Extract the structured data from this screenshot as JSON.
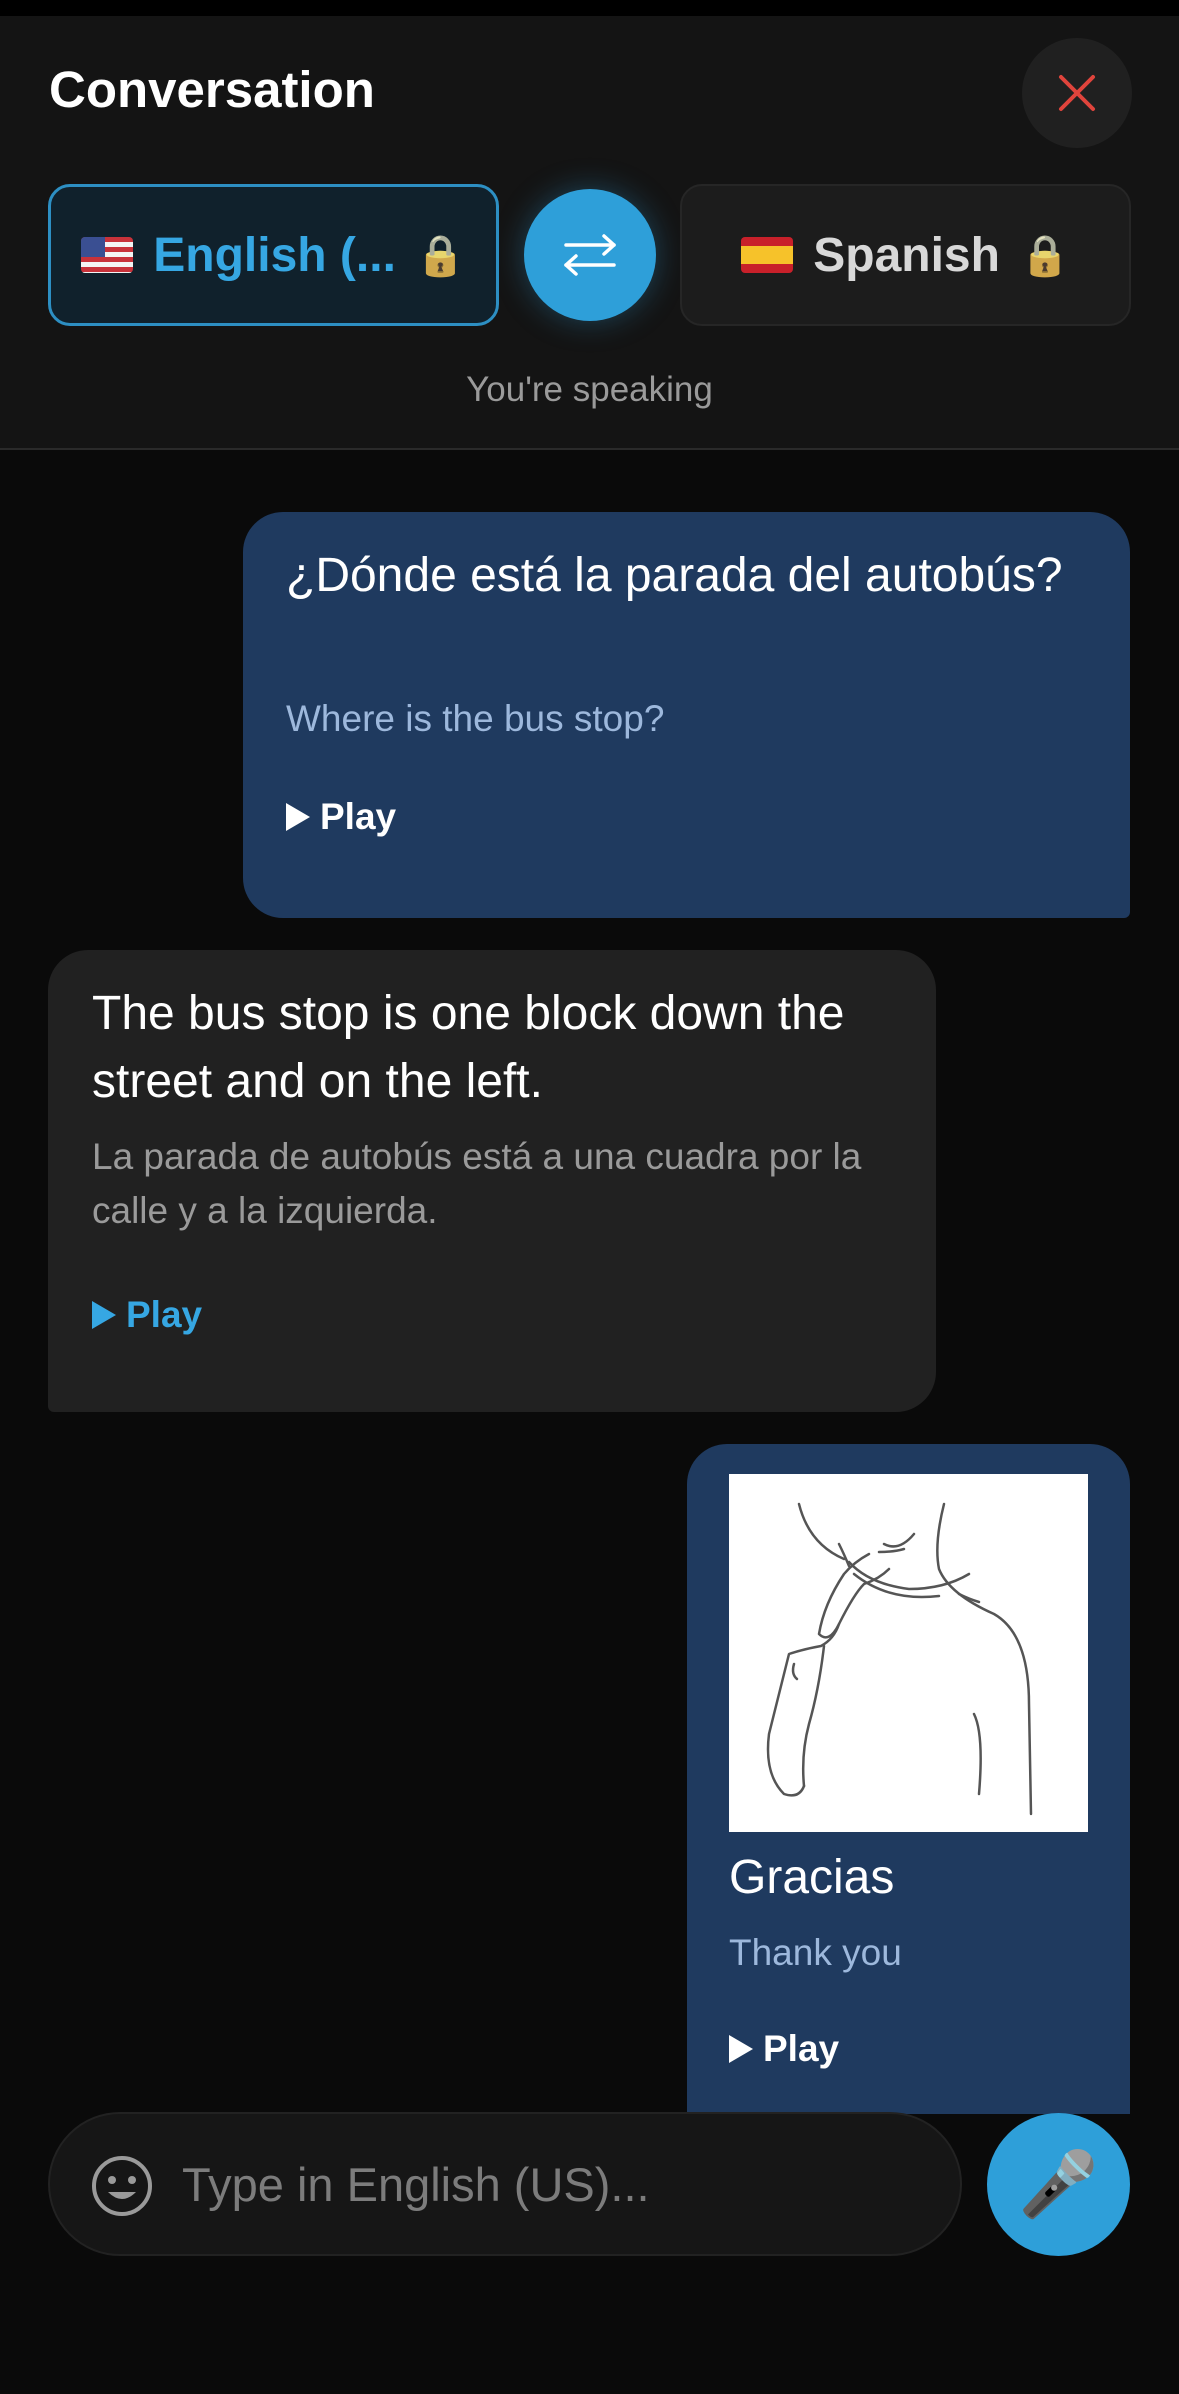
{
  "header": {
    "title": "Conversation",
    "speaking_status": "You're speaking",
    "source_language": {
      "label": "English (...",
      "flag": "us-flag",
      "lock": "🔒"
    },
    "target_language": {
      "label": "Spanish",
      "flag": "es-flag",
      "lock": "🔒"
    }
  },
  "messages": [
    {
      "side": "right",
      "text": "¿Dónde está la parada del autobús?",
      "translation": "Where is the bus stop?",
      "play_label": "Play"
    },
    {
      "side": "left",
      "text": "The bus stop is one block down the street and on the left.",
      "translation": "La parada de autobús está a una cuadra por la calle y a la izquierda.",
      "play_label": "Play"
    },
    {
      "side": "right",
      "image": "sign-language-thank-you-illustration",
      "text": "Gracias",
      "translation": "Thank you",
      "play_label": "Play"
    }
  ],
  "input": {
    "placeholder": "Type in English (US)...",
    "mic": "🎤"
  },
  "colors": {
    "accent": "#2e9fd9",
    "outgoing_bubble": "#1f3a5f",
    "incoming_bubble": "#212121",
    "close": "#e0443c"
  }
}
